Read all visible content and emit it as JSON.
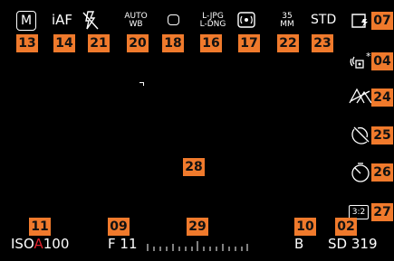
{
  "top_bar": {
    "exposure_mode": "M",
    "focus_mode": "iAF",
    "wb_line1": "AUTO",
    "wb_line2": "WB",
    "file_format_line1": "L-JPG",
    "file_format_line2": "L-DNG",
    "film_mode_line1": "35",
    "film_mode_line2": "MM",
    "style": "STD"
  },
  "right_column": {
    "aspect_ratio": "3:2"
  },
  "bottom_bar": {
    "iso_prefix": "ISO",
    "iso_auto": "A",
    "iso_value": "100",
    "aperture_prefix": "F",
    "aperture_value": "11",
    "shutter": "B",
    "card_label": "SD",
    "shots_remaining": "319"
  },
  "badges": {
    "b13": "13",
    "b14": "14",
    "b21": "21",
    "b20": "20",
    "b18": "18",
    "b16": "16",
    "b17": "17",
    "b22": "22",
    "b23": "23",
    "b07": "07",
    "b04": "04",
    "b24": "24",
    "b25": "25",
    "b26": "26",
    "b27": "27",
    "b28": "28",
    "b11": "11",
    "b09": "09",
    "b29": "29",
    "b10": "10",
    "b02": "02"
  },
  "colors": {
    "badge": "#f07a2c",
    "iso_auto": "#e0202a",
    "background": "#000000"
  }
}
